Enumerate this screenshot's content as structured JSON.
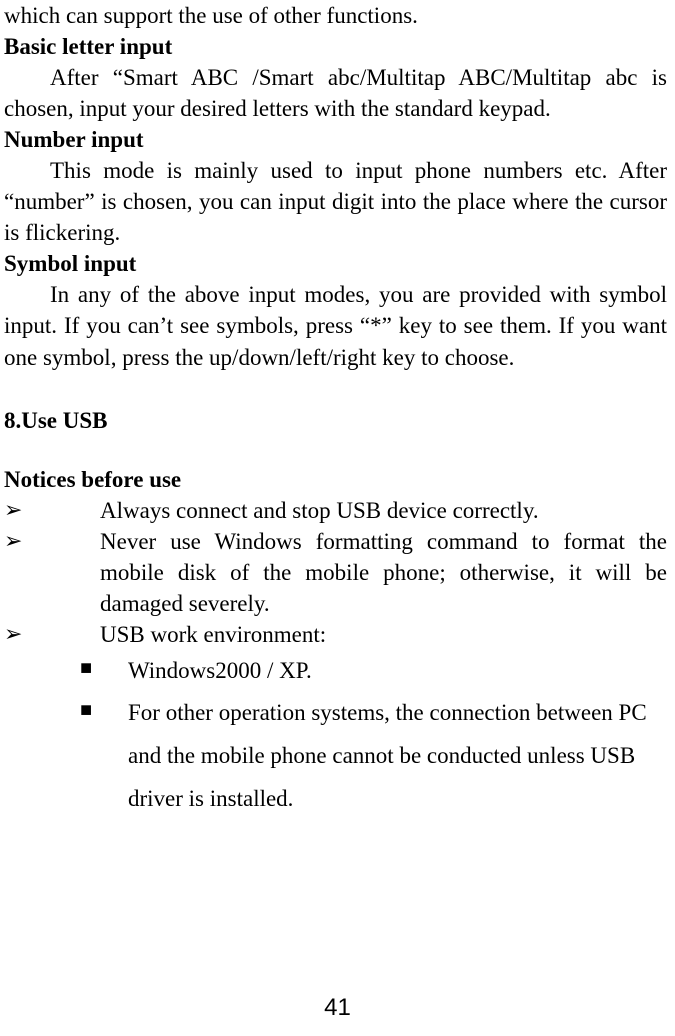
{
  "lead_in": "which can support the use of other functions.",
  "sections": {
    "basic_letter": {
      "heading": "Basic letter input",
      "body": "After “Smart ABC /Smart abc/Multitap ABC/Multitap abc is chosen, input your desired letters with the standard keypad."
    },
    "number_input": {
      "heading": "Number input",
      "body": "This mode is mainly used to input phone numbers etc. After “number” is chosen, you can input digit into the place where the cursor is flickering."
    },
    "symbol_input": {
      "heading": "Symbol input",
      "body": "In any of the above input modes, you are provided with symbol input. If you can’t see symbols, press “*” key to see them. If you want one symbol, press the up/down/left/right key to choose."
    }
  },
  "usb": {
    "heading": "8.Use USB",
    "notices_heading": "Notices before use",
    "bullet_marker": "➢",
    "square_marker": "■",
    "items": [
      "Always connect and stop USB device correctly.",
      "Never use Windows formatting command to format the mobile disk of the mobile phone; otherwise, it will be damaged severely.",
      "USB work environment:"
    ],
    "sub_items": [
      "Windows2000 / XP.",
      "For other operation systems, the connection between PC and the mobile phone cannot be conducted unless USB driver is installed."
    ]
  },
  "page_number": "41"
}
